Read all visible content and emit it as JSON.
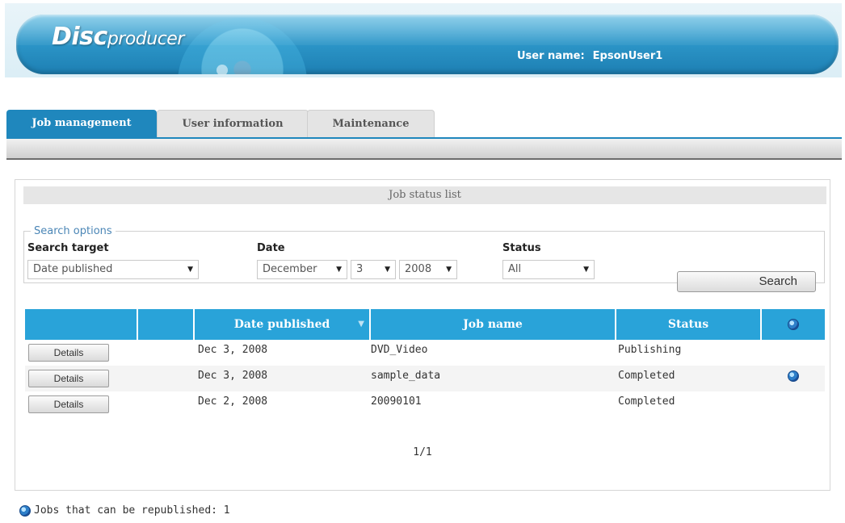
{
  "header": {
    "logo_bold": "Disc",
    "logo_rest": "producer",
    "user_label": "User name:",
    "user_name": "EpsonUser1"
  },
  "tabs": [
    {
      "label": "Job management",
      "active": true
    },
    {
      "label": "User information",
      "active": false
    },
    {
      "label": "Maintenance",
      "active": false
    }
  ],
  "panel": {
    "title": "Job status list",
    "search": {
      "legend": "Search options",
      "target_label": "Search target",
      "target_value": "Date published",
      "date_label": "Date",
      "month": "December",
      "day": "3",
      "year": "2008",
      "status_label": "Status",
      "status_value": "All",
      "search_button": "Search"
    },
    "table": {
      "headers": [
        "",
        "",
        "Date published",
        "Job name",
        "Status",
        "globe-icon"
      ],
      "rows": [
        {
          "button": "Details",
          "date": "Dec 3, 2008",
          "job": "DVD_Video",
          "status": "Publishing",
          "republishable": false
        },
        {
          "button": "Details",
          "date": "Dec 3, 2008",
          "job": "sample_data",
          "status": "Completed",
          "republishable": true
        },
        {
          "button": "Details",
          "date": "Dec 2, 2008",
          "job": "20090101",
          "status": "Completed",
          "republishable": false
        }
      ]
    },
    "pager": "1/1"
  },
  "footer": {
    "republish_text": "Jobs that can be republished: 1"
  },
  "colors": {
    "accent": "#1f87bd",
    "table_header": "#29a3d9"
  }
}
